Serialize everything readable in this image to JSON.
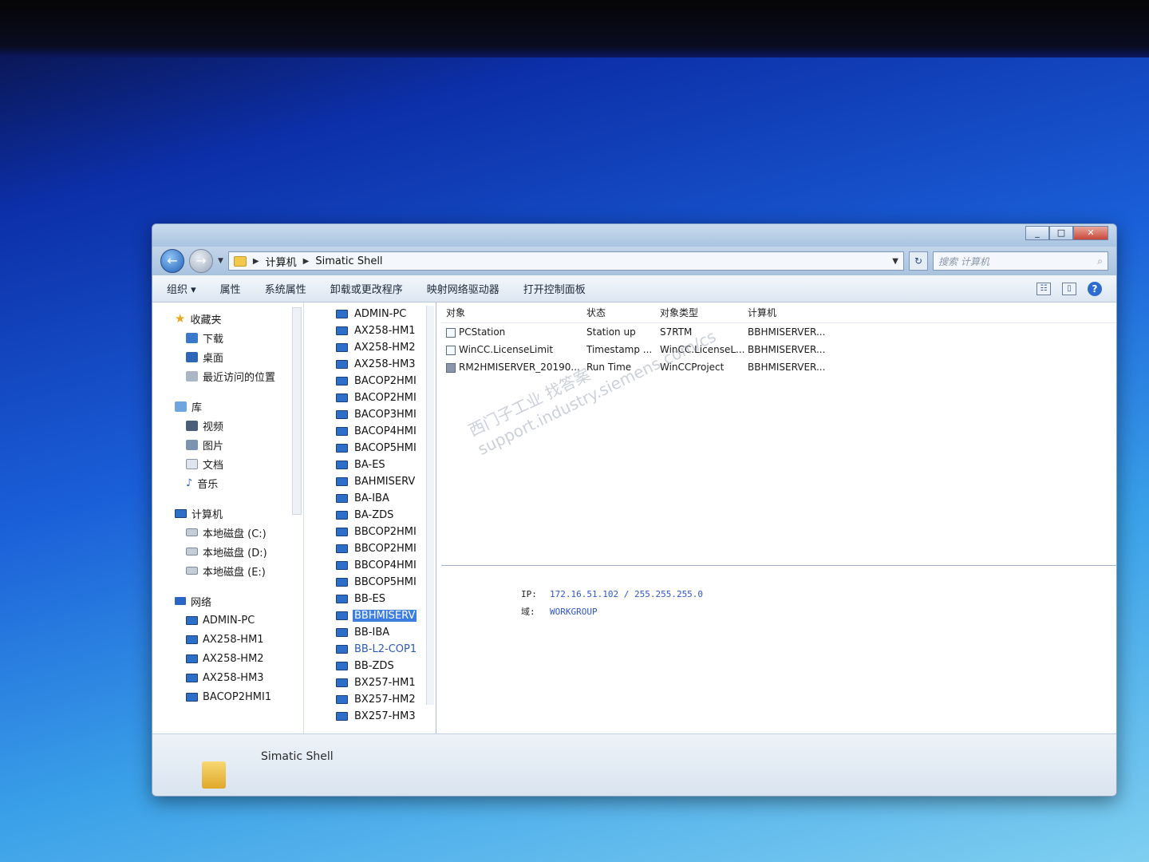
{
  "window": {
    "controls": [
      "_",
      "□",
      "✕"
    ]
  },
  "nav": {
    "breadcrumb": [
      "计算机",
      "Simatic Shell"
    ],
    "search_placeholder": "搜索 计算机"
  },
  "toolbar": {
    "organize": "组织 ▾",
    "properties": "属性",
    "system_properties": "系统属性",
    "uninstall": "卸载或更改程序",
    "map_drive": "映射网络驱动器",
    "control_panel": "打开控制面板"
  },
  "sidebar": {
    "favorites": {
      "label": "收藏夹",
      "items": [
        "下载",
        "桌面",
        "最近访问的位置"
      ]
    },
    "libraries": {
      "label": "库",
      "items": [
        "视频",
        "图片",
        "文档",
        "音乐"
      ]
    },
    "computer": {
      "label": "计算机",
      "items": [
        "本地磁盘 (C:)",
        "本地磁盘 (D:)",
        "本地磁盘 (E:)"
      ]
    },
    "network": {
      "label": "网络",
      "items": [
        "ADMIN-PC",
        "AX258-HM1",
        "AX258-HM2",
        "AX258-HM3",
        "BACOP2HMI1"
      ]
    }
  },
  "tree": {
    "items": [
      "ADMIN-PC",
      "AX258-HM1",
      "AX258-HM2",
      "AX258-HM3",
      "BACOP2HMI",
      "BACOP2HMI",
      "BACOP3HMI",
      "BACOP4HMI",
      "BACOP5HMI",
      "BA-ES",
      "BAHMISERV",
      "BA-IBA",
      "BA-ZDS",
      "BBCOP2HMI",
      "BBCOP2HMI",
      "BBCOP4HMI",
      "BBCOP5HMI",
      "BB-ES",
      "BBHMISERV",
      "BB-IBA",
      "BB-L2-COP1",
      "BB-ZDS",
      "BX257-HM1",
      "BX257-HM2",
      "BX257-HM3"
    ],
    "selected_index": 18,
    "link_index": 20
  },
  "list": {
    "headers": [
      "对象",
      "状态",
      "对象类型",
      "计算机"
    ],
    "rows": [
      [
        "PCStation",
        "Station up",
        "S7RTM",
        "BBHMISERVER..."
      ],
      [
        "WinCC.LicenseLimit",
        "Timestamp ...",
        "WinCC.LicenseL...",
        "BBHMISERVER..."
      ],
      [
        "RM2HMISERVER_20190...",
        "Run Time",
        "WinCCProject",
        "BBHMISERVER..."
      ]
    ]
  },
  "details": {
    "ip_label": "IP:",
    "ip_value": "172.16.51.102 / 255.255.255.0",
    "domain_label": "域:",
    "domain_value": "WORKGROUP"
  },
  "watermark": {
    "line1": "西门子工业   找答案",
    "line2": "support.industry.siemens.com/cs"
  },
  "status": {
    "title": "Simatic Shell"
  }
}
